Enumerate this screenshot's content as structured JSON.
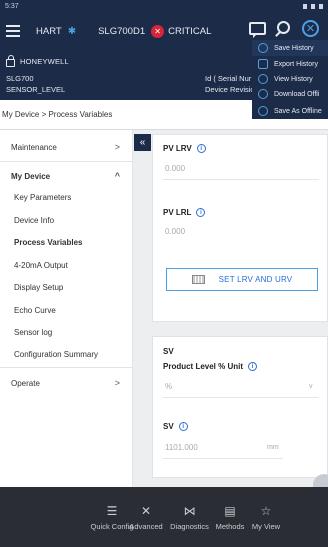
{
  "statusbar": {
    "time": "5:37"
  },
  "header": {
    "protocol": "HART",
    "device": "SLG700D1",
    "status": "CRITICAL"
  },
  "device_info": {
    "brand": "HONEYWELL",
    "model": "SLG700",
    "tag": "SENSOR_LEVEL",
    "id_serial": "Id ( Serial Nur",
    "device_revision": "Device Revisio"
  },
  "breadcrumb": "My Device > Process Variables",
  "sidebar": {
    "maintenance": "Maintenance",
    "my_device": "My Device",
    "items": [
      "Key Parameters",
      "Device Info",
      "Process Variables",
      "4-20mA Output",
      "Display Setup",
      "Echo Curve",
      "Sensor log",
      "Configuration Summary"
    ],
    "operate": "Operate"
  },
  "lrv_card": {
    "pv_lrv_label": "PV LRV",
    "pv_lrv_value": "0.000",
    "pv_lrl_label": "PV LRL",
    "pv_lrl_value": "0.000",
    "set_button": "SET LRV AND URV"
  },
  "sv_card": {
    "section": "SV",
    "unit_label": "Product Level % Unit",
    "unit_value": "%",
    "sv_label": "SV",
    "sv_value": "1101.000",
    "sv_unit": "mm"
  },
  "menu": {
    "items": [
      "Save History",
      "Export History",
      "View History",
      "Download Offli",
      "Save As Offline"
    ]
  },
  "bottom_nav": {
    "items": [
      {
        "label": "Quick Config",
        "icon": "sliders-icon"
      },
      {
        "label": "Advanced",
        "icon": "tools-icon"
      },
      {
        "label": "Diagnostics",
        "icon": "diagnostics-icon"
      },
      {
        "label": "Methods",
        "icon": "methods-icon"
      },
      {
        "label": "My View",
        "icon": "star-icon"
      }
    ]
  },
  "colors": {
    "header_bg": "#1c2b47",
    "accent": "#4ea0e0",
    "critical": "#d9253a",
    "nav_bg": "#2a2d33"
  }
}
